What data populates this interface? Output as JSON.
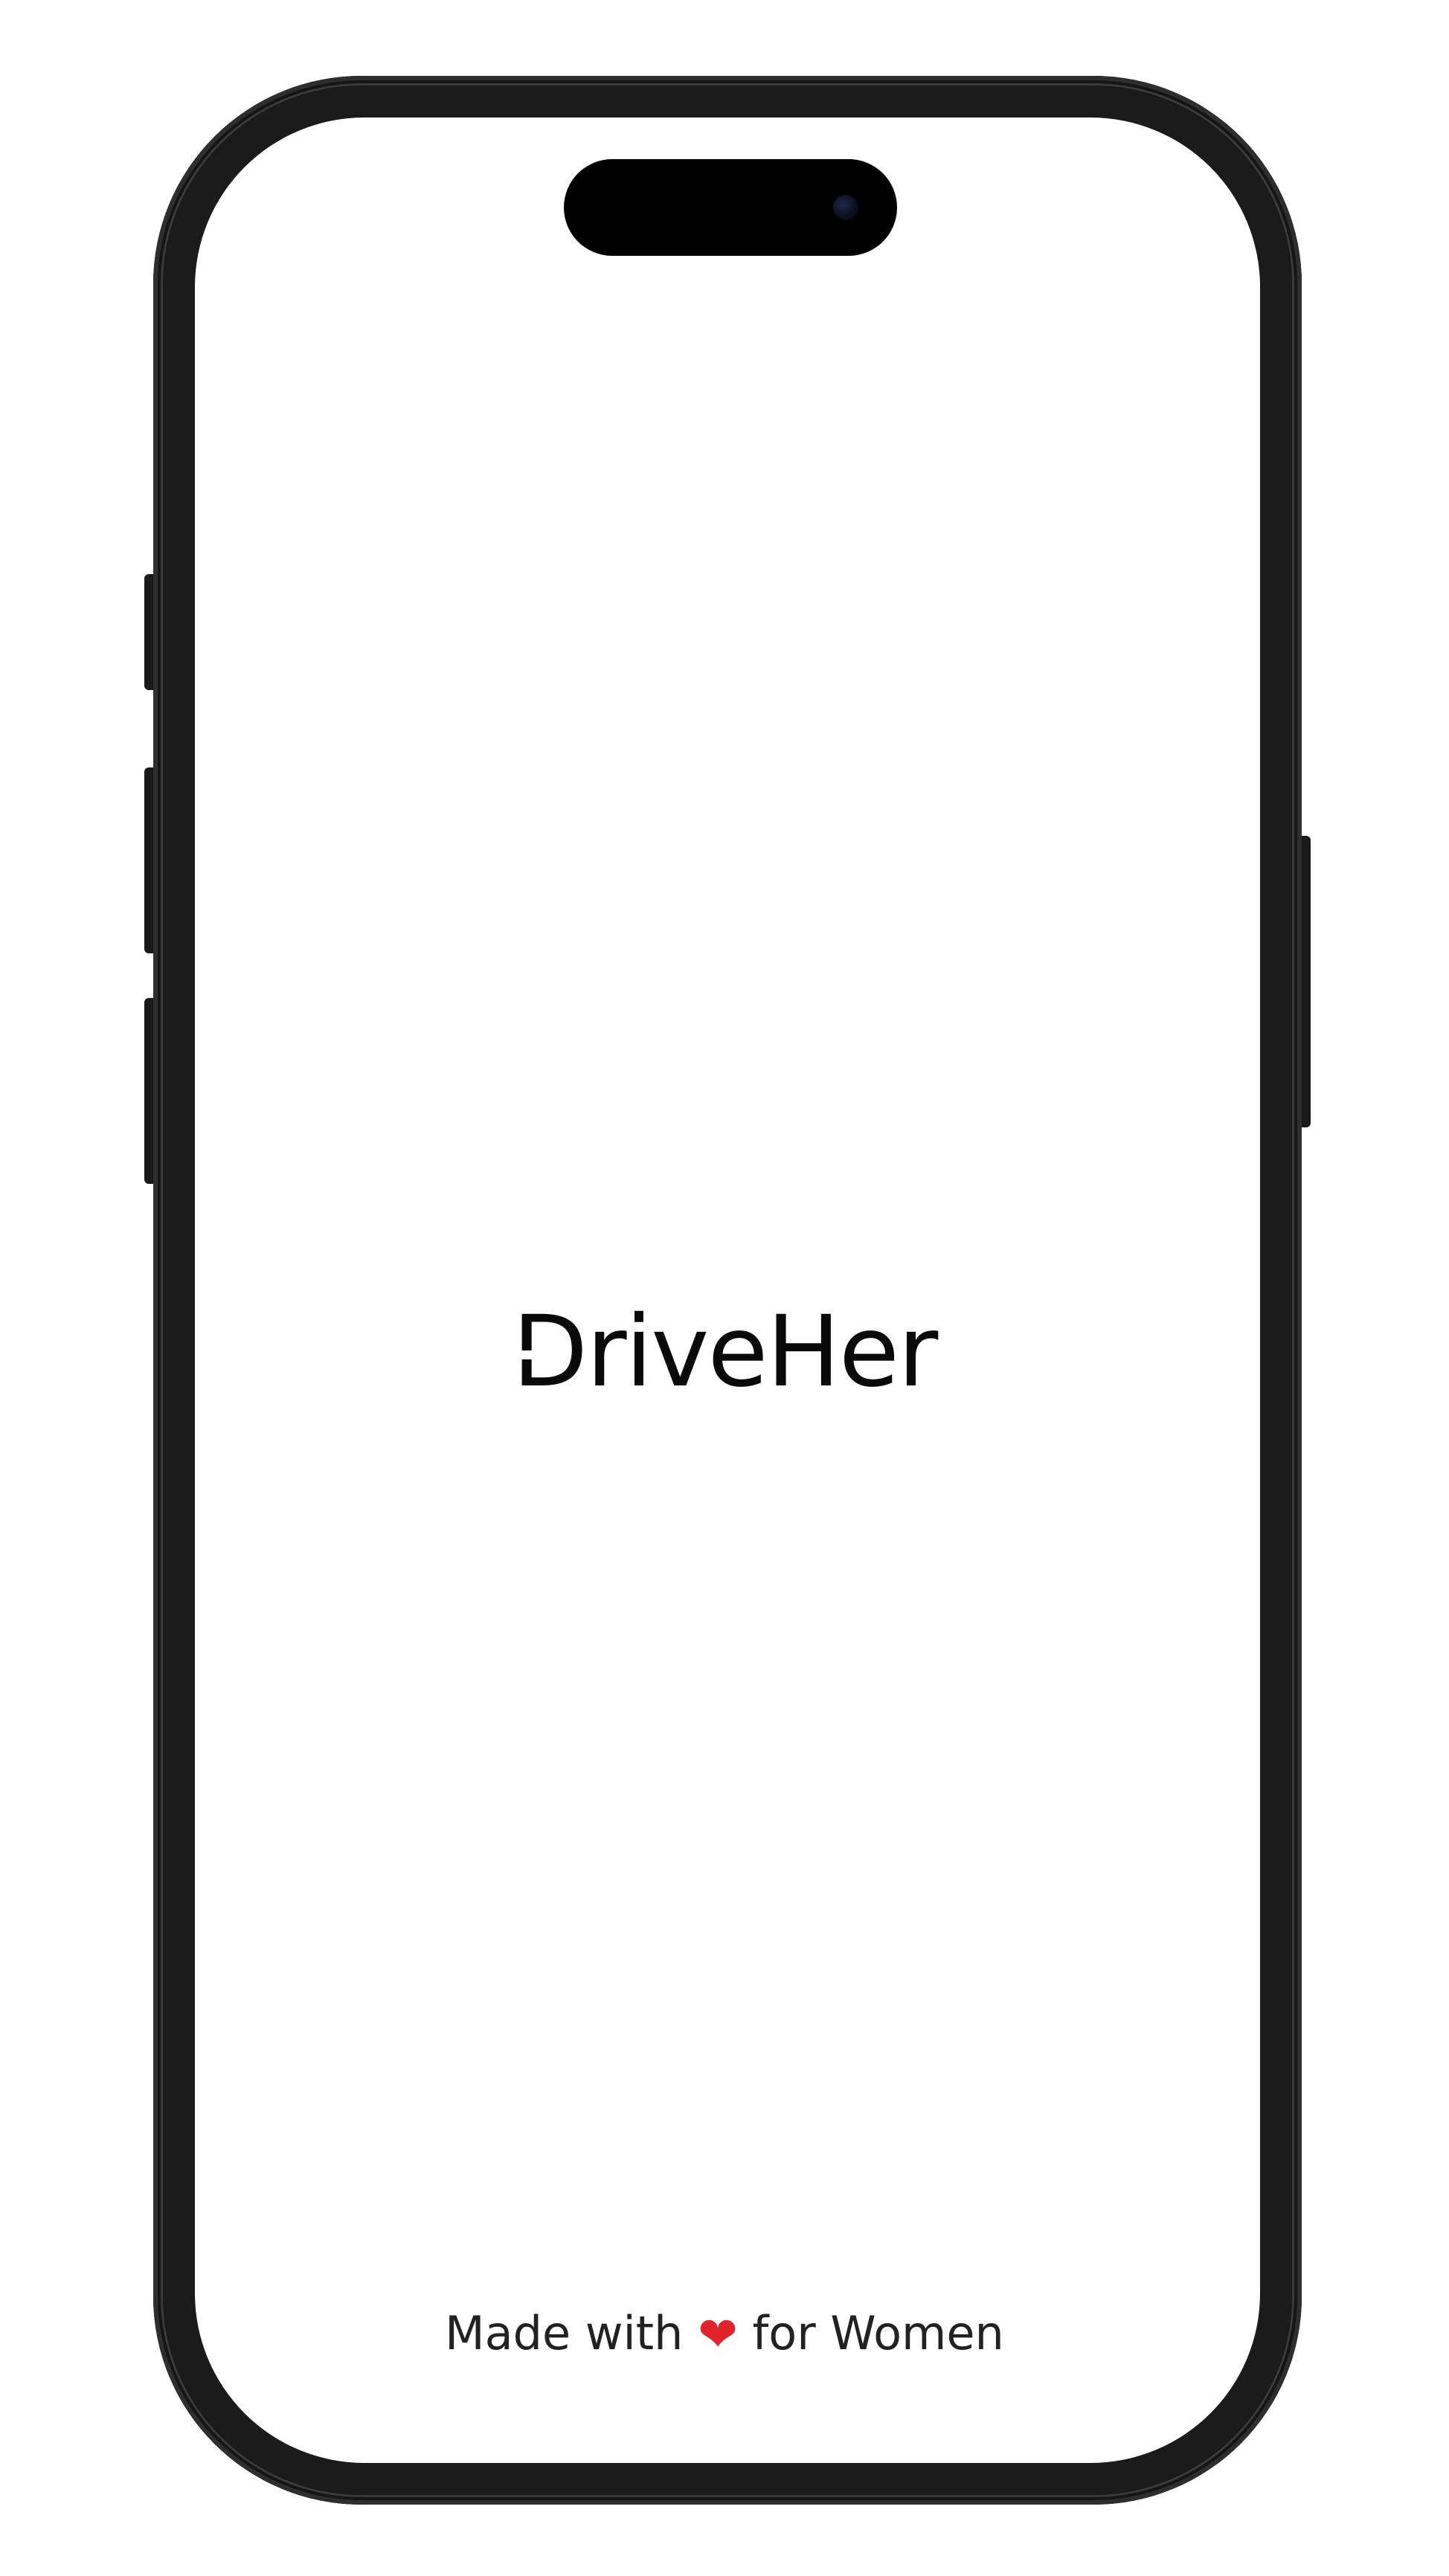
{
  "app": {
    "logo_text": "DriveHer",
    "tagline_before": "Made with",
    "tagline_heart": "❤",
    "tagline_after": "for Women"
  },
  "device": {
    "frame_color": "#1b1b1b",
    "screen_color": "#ffffff"
  },
  "colors": {
    "logo": "#0a0a0a",
    "tagline": "#222222",
    "heart": "#e0242b"
  },
  "icons": {
    "heart": "heart-icon"
  }
}
